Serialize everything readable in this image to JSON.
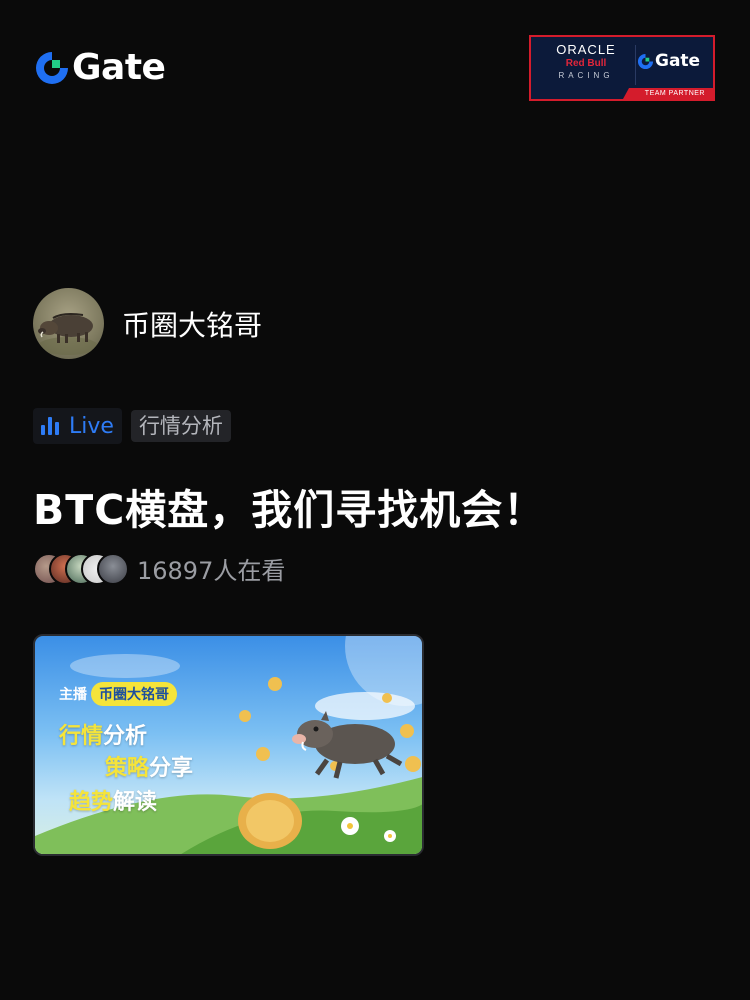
{
  "brand": {
    "logo_text": "Gate",
    "accent_blue": "#1f6ff2",
    "accent_green": "#22cc88"
  },
  "partner_badge": {
    "oracle": "ORACLE",
    "red_bull": "Red Bull",
    "racing": "RACING",
    "gate_text": "Gate",
    "team_partner": "TEAM PARTNER"
  },
  "host": {
    "name": "币圈大铭哥"
  },
  "tags": {
    "live": "Live",
    "category": "行情分析"
  },
  "stream": {
    "title": "BTC横盘，我们寻找机会！",
    "viewer_count": "16897人在看"
  },
  "cover": {
    "host_label": "主播",
    "host_name": "币圈大铭哥",
    "line1_highlight": "行情",
    "line1_rest": "分析",
    "line2_highlight": "策略",
    "line2_rest": "分享",
    "line3_highlight": "趋势",
    "line3_rest": "解读"
  }
}
